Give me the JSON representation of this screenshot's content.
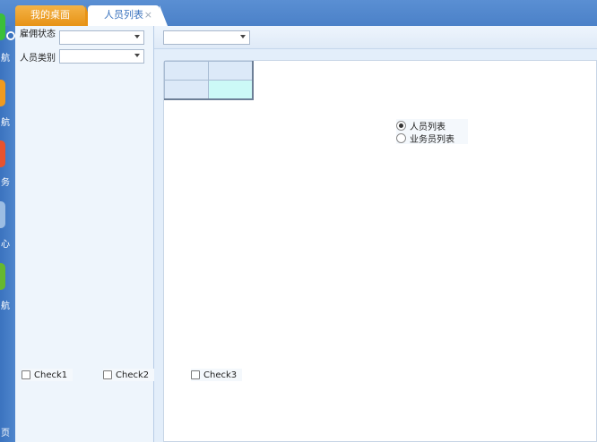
{
  "tabs": [
    {
      "label": "我的桌面"
    },
    {
      "label": "人员列表",
      "close": "×"
    }
  ],
  "dock": {
    "items": [
      {
        "label": "航",
        "color": "#3bbf3a"
      },
      {
        "label": "航",
        "color": "#f09a1f"
      },
      {
        "label": "务",
        "color": "#e8532d"
      },
      {
        "label": "心",
        "color": "#9cbde3"
      },
      {
        "label": "航",
        "color": "#66b82f"
      },
      {
        "label": "页",
        "color": ""
      }
    ]
  },
  "filters": [
    {
      "label": "雇佣状态",
      "value": ""
    },
    {
      "label": "人员类别",
      "value": ""
    }
  ],
  "content_combo": {
    "value": ""
  },
  "radios": [
    {
      "label": "人员列表",
      "checked": true
    },
    {
      "label": "业务员列表",
      "checked": false
    }
  ],
  "checks": [
    {
      "label": "Check1"
    },
    {
      "label": "Check2"
    },
    {
      "label": "Check3"
    }
  ],
  "colors": {
    "tab_bar": "#4b81c8",
    "active_tab_text": "#3a73be",
    "desk_tab": "#e79316",
    "selected_cell": "#ccf9f7"
  }
}
